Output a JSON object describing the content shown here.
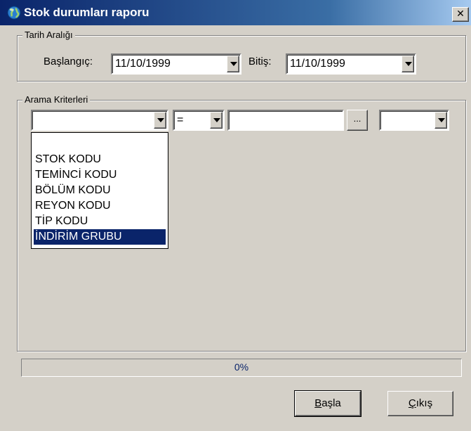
{
  "window": {
    "title": "Stok durumları raporu",
    "close_glyph": "✕"
  },
  "date_range": {
    "legend": "Tarih Aralığı",
    "start_label": "Başlangıç:",
    "start_value": "11/10/1999",
    "end_label": "Bitiş:",
    "end_value": "11/10/1999"
  },
  "search": {
    "legend": "Arama Kriterleri",
    "field_value": "",
    "operator_value": "=",
    "search_value": "",
    "ellipsis_label": "...",
    "extra_value": "",
    "field_options": [
      "",
      "STOK KODU",
      "TEMİNCİ KODU",
      "BÖLÜM KODU",
      "REYON KODU",
      "TİP KODU",
      "İNDİRİM GRUBU"
    ],
    "selected_index": 6
  },
  "progress": {
    "value": 0,
    "label": "0%"
  },
  "buttons": {
    "start_first": "B",
    "start_rest": "aşla",
    "exit_first": "Ç",
    "exit_rest": "ıkış"
  },
  "colors": {
    "face": "#d4d0c8",
    "title_start": "#0a246a",
    "title_end": "#a6caf0",
    "selection": "#0a246a"
  },
  "icons": {
    "title": "globe-icon",
    "close": "close-icon",
    "dropdown": "chevron-down-icon"
  }
}
